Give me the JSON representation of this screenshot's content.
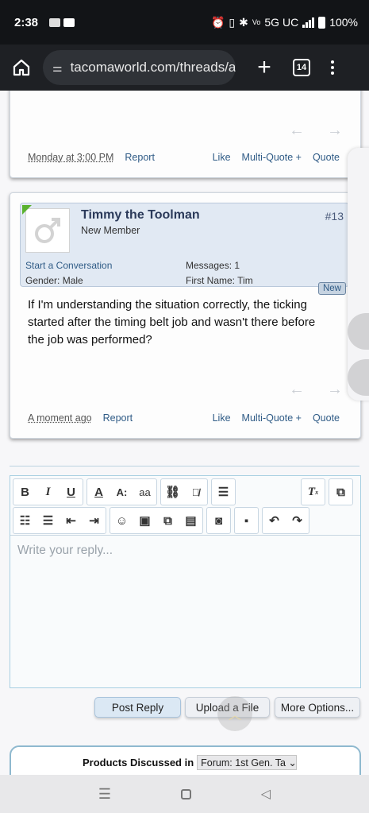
{
  "status_bar": {
    "time": "2:38",
    "network": "5G UC",
    "battery": "100%"
  },
  "browser": {
    "url": "tacomaworld.com/threads/ar",
    "tab_count": "14"
  },
  "previous_post": {
    "date": "Monday at 3:00 PM",
    "report": "Report",
    "like": "Like",
    "multi_quote": "Multi-Quote +",
    "quote": "Quote"
  },
  "post": {
    "username": "Timmy the Toolman",
    "user_title": "New Member",
    "post_number": "#13",
    "start_conversation": "Start a Conversation",
    "gender_label": "Gender:",
    "gender_value": "Male",
    "messages_label": "Messages:",
    "messages_value": "1",
    "first_name_label": "First Name:",
    "first_name_value": "Tim",
    "new_badge": "New",
    "message": "If I'm understanding the situation correctly, the ticking started after the timing belt job and wasn't there before the job was performed?",
    "date": "A moment ago",
    "report": "Report",
    "like": "Like",
    "multi_quote": "Multi-Quote +",
    "quote": "Quote"
  },
  "editor": {
    "placeholder": "Write your reply..."
  },
  "buttons": {
    "post_reply": "Post Reply",
    "upload_file": "Upload a File",
    "more_options": "More Options..."
  },
  "products": {
    "label": "Products Discussed in",
    "forum_select": "Forum: 1st Gen. Ta"
  }
}
